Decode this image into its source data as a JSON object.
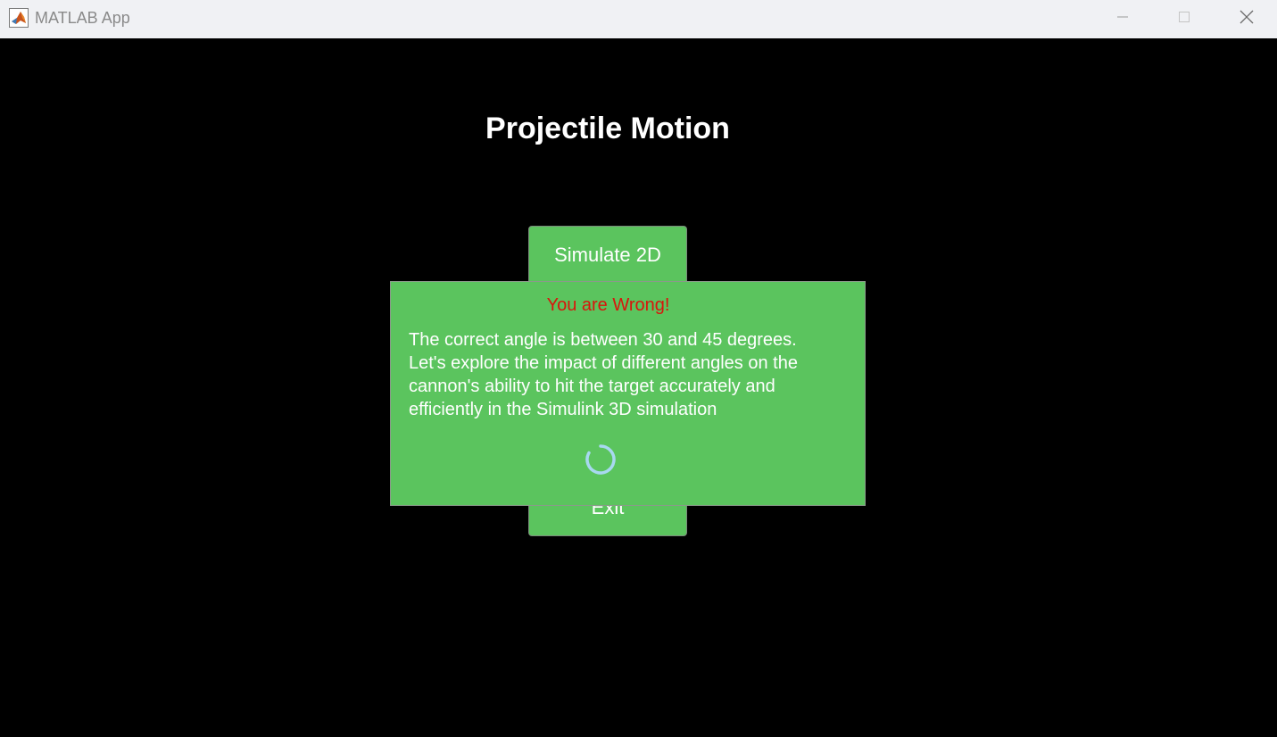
{
  "window": {
    "title": "MATLAB App",
    "app_icon": "matlab-logo-icon",
    "controls": [
      "minimize-icon",
      "maximize-icon",
      "close-icon"
    ]
  },
  "main": {
    "title": "Projectile Motion",
    "buttons": {
      "simulate_2d": "Simulate 2D",
      "exit": "Exit"
    }
  },
  "dialog": {
    "title": "You are Wrong!",
    "message": "The correct angle is between 30 and 45 degrees. Let's explore the impact of different angles on the cannon's ability to hit the target accurately and efficiently in the Simulink 3D simulation",
    "spinner_icon": "loading-spinner-icon"
  },
  "colors": {
    "background": "#000000",
    "button_green": "#5bc45e",
    "dialog_title_red": "#d9150c",
    "spinner_blue": "#a8d8f0"
  }
}
